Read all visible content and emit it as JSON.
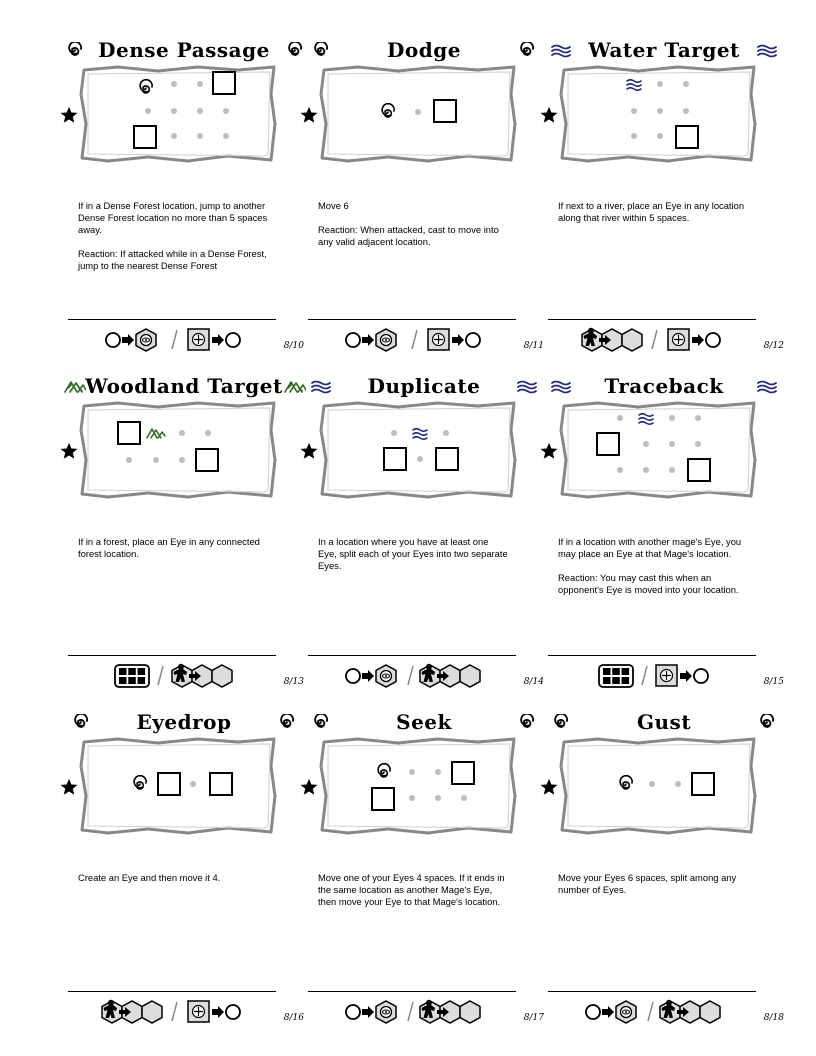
{
  "colors": {
    "spiral": "#000000",
    "water": "#1f2a8a",
    "forest": "#2e6b1e",
    "dot": "#bdbdbd",
    "parchment_edge": "#8a8a8a"
  },
  "cards": [
    {
      "id": "dense-passage",
      "title": "Dense Passage",
      "icon": "spiral",
      "description": "If in a Dense Forest location, jump to another Dense Forest location no more than 5 spaces away.\n\nReaction: If attacked while in a Dense Forest, jump to the nearest Dense Forest",
      "cost_left": "eye-from-circle",
      "cost_right": "move-to-circle",
      "page": "8/10"
    },
    {
      "id": "dodge",
      "title": "Dodge",
      "icon": "spiral",
      "description": "Move 6\n\nReaction: When attacked, cast to move into any valid adjacent location.",
      "cost_left": "eye-from-circle",
      "cost_right": "move-to-circle",
      "page": "8/11"
    },
    {
      "id": "water-target",
      "title": "Water Target",
      "icon": "water",
      "description": "If next to a river, place an Eye in any location along that river within 5 spaces.",
      "cost_left": "meeple-hex",
      "cost_right": "move-to-circle",
      "page": "8/12"
    },
    {
      "id": "woodland-target",
      "title": "Woodland Target",
      "icon": "forest",
      "description": "If in a forest, place an Eye in any connected forest location.",
      "cost_left": "grid",
      "cost_right": "meeple-hex",
      "page": "8/13"
    },
    {
      "id": "duplicate",
      "title": "Duplicate",
      "icon": "water",
      "description": "In a location where you have at least one Eye, split each of your Eyes into two separate Eyes.",
      "cost_left": "eye-from-circle",
      "cost_right": "meeple-hex",
      "page": "8/14"
    },
    {
      "id": "traceback",
      "title": "Traceback",
      "icon": "water",
      "description": "If in a location with another mage's Eye, you may place an Eye at that Mage's location.\n\nReaction: You may cast this when an opponent's Eye is moved into your location.",
      "cost_left": "grid",
      "cost_right": "move-to-circle",
      "page": "8/15"
    },
    {
      "id": "eyedrop",
      "title": "Eyedrop",
      "icon": "spiral",
      "description": "Create an Eye and then move it 4.",
      "cost_left": "meeple-hex",
      "cost_right": "move-to-circle",
      "page": "8/16"
    },
    {
      "id": "seek",
      "title": "Seek",
      "icon": "spiral",
      "description": "Move one of your Eyes 4 spaces. If it ends in the same location as another Mage's Eye, then move your Eye to that Mage's location.",
      "cost_left": "eye-from-circle",
      "cost_right": "meeple-hex",
      "page": "8/17"
    },
    {
      "id": "gust",
      "title": "Gust",
      "icon": "spiral",
      "description": "Move your Eyes 6 spaces, split among any number of Eyes.",
      "cost_left": "eye-from-circle",
      "cost_right": "meeple-hex",
      "page": "8/18"
    }
  ]
}
